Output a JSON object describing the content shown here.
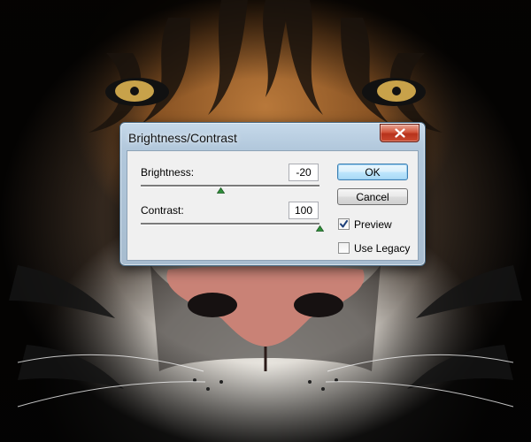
{
  "dialog": {
    "title": "Brightness/Contrast",
    "brightness": {
      "label": "Brightness:",
      "value": "-20",
      "slider_fraction": 0.45
    },
    "contrast": {
      "label": "Contrast:",
      "value": "100",
      "slider_fraction": 1.0
    },
    "buttons": {
      "ok": "OK",
      "cancel": "Cancel"
    },
    "preview": {
      "label": "Preview",
      "checked": true
    },
    "use_legacy": {
      "label": "Use Legacy",
      "checked": false
    },
    "icons": {
      "close": "close-icon",
      "checkmark": "checkmark-icon",
      "slider_thumb": "triangle-up-icon"
    },
    "colors": {
      "close_button": "#c94a2f",
      "slider_thumb": "#2f8f3a",
      "ok_border": "#3c7fb1"
    }
  }
}
